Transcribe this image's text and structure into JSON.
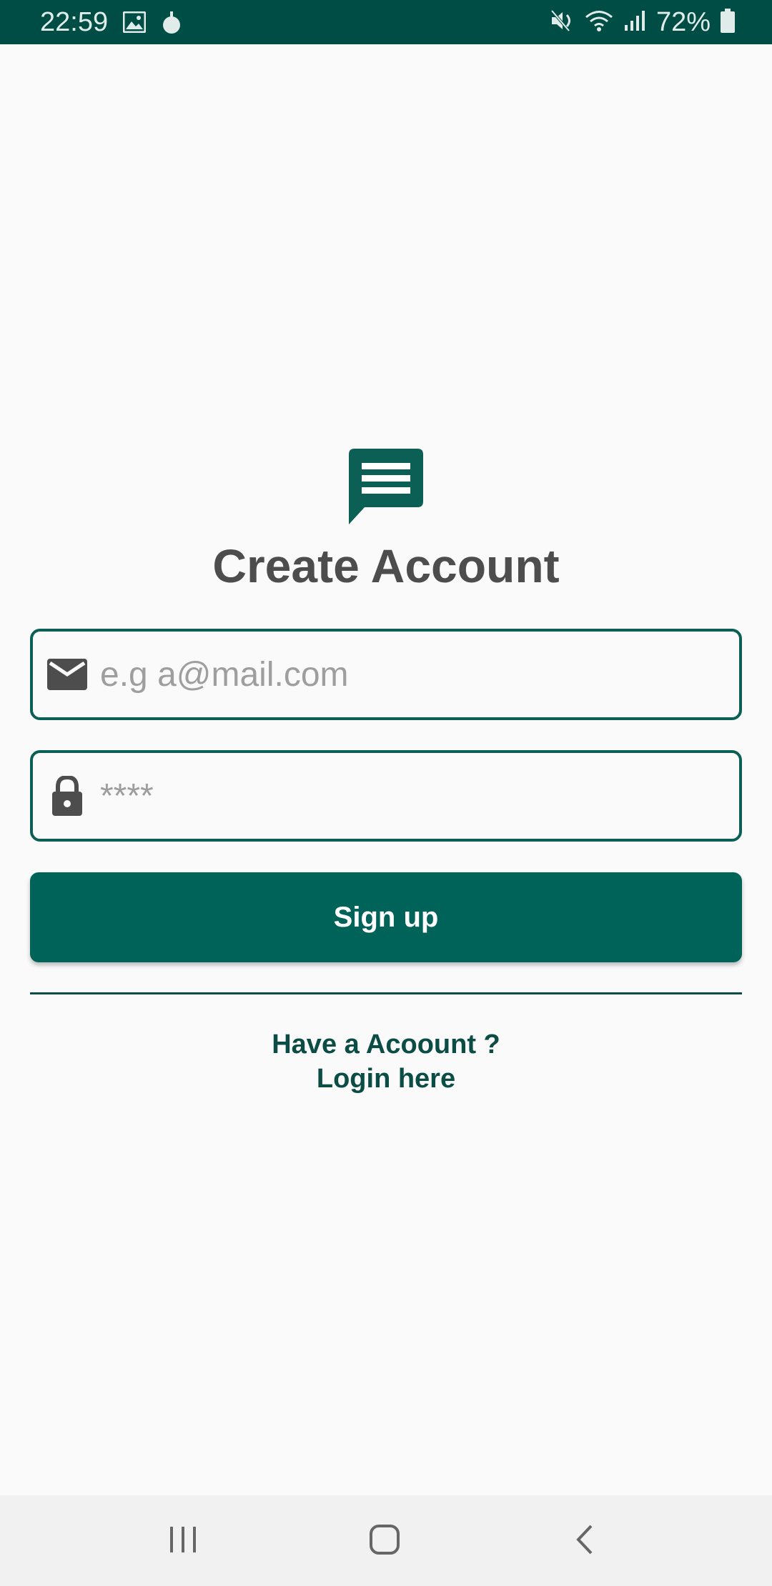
{
  "status_bar": {
    "time": "22:59",
    "battery": "72%"
  },
  "header": {
    "title": "Create Account"
  },
  "form": {
    "email": {
      "value": "",
      "placeholder": "e.g a@mail.com"
    },
    "password": {
      "value": "",
      "placeholder": "****"
    },
    "signup_label": "Sign up"
  },
  "footer": {
    "login_line1": "Have a Acoount ?",
    "login_line2": "Login here"
  },
  "icons": {
    "logo": "chat-message-icon",
    "email": "mail-icon",
    "password": "lock-icon"
  },
  "colors": {
    "primary": "#00635a",
    "status_bar": "#004d45",
    "title_text": "#4d4d4d",
    "link_text": "#0b4d45"
  }
}
